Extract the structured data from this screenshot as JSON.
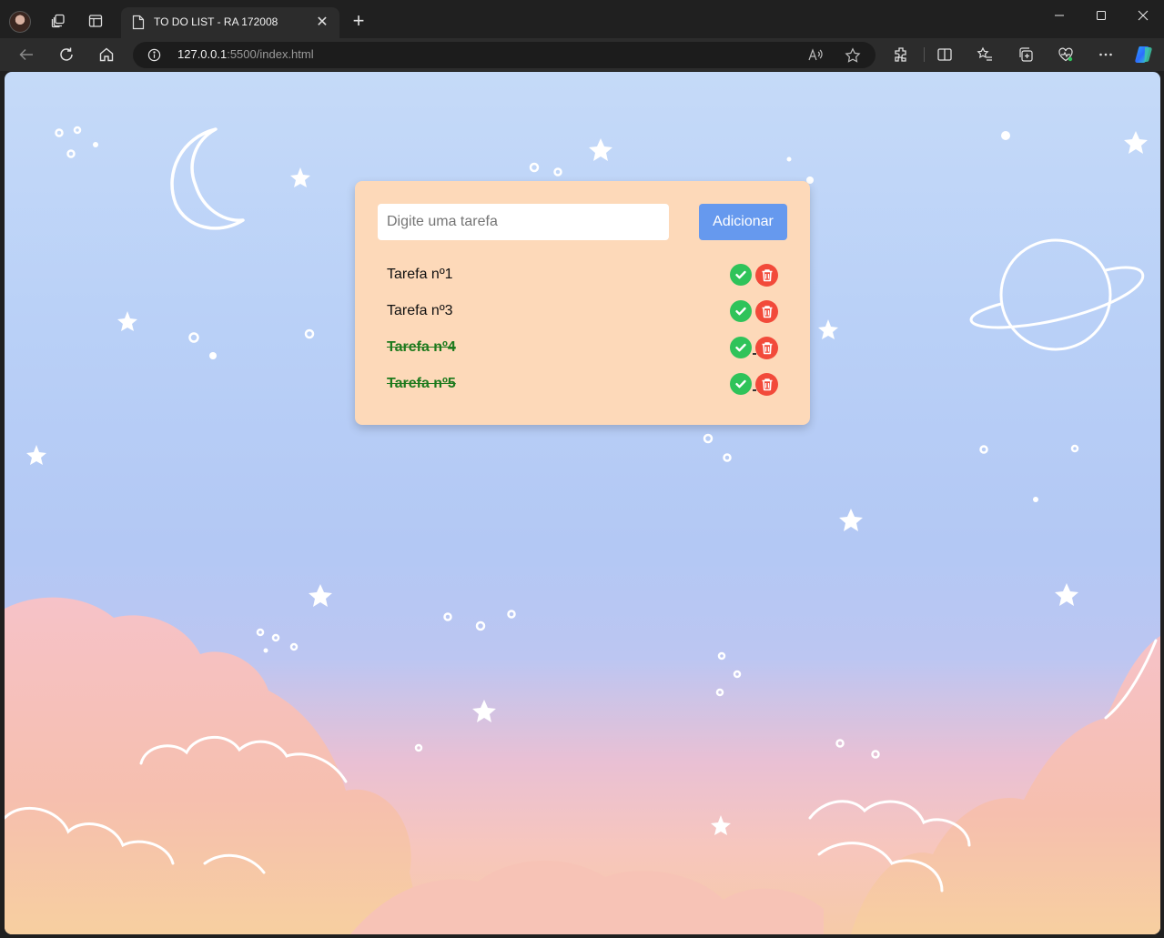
{
  "browser": {
    "tab_title": "TO DO LIST - RA 172008",
    "url_host": "127.0.0.1",
    "url_path": ":5500/index.html"
  },
  "app": {
    "input_placeholder": "Digite uma tarefa",
    "input_value": "",
    "add_button_label": "Adicionar",
    "tasks": [
      {
        "label": "Tarefa nº1",
        "done": false
      },
      {
        "label": "Tarefa nº3",
        "done": false
      },
      {
        "label": "Tarefa nº4",
        "done": true
      },
      {
        "label": "Tarefa nº5",
        "done": true
      }
    ]
  },
  "colors": {
    "card": "#fdd9b9",
    "add_button": "#6699ee",
    "check": "#2fc35a",
    "delete": "#f24a3a",
    "done_text": "#1d7a1d"
  }
}
